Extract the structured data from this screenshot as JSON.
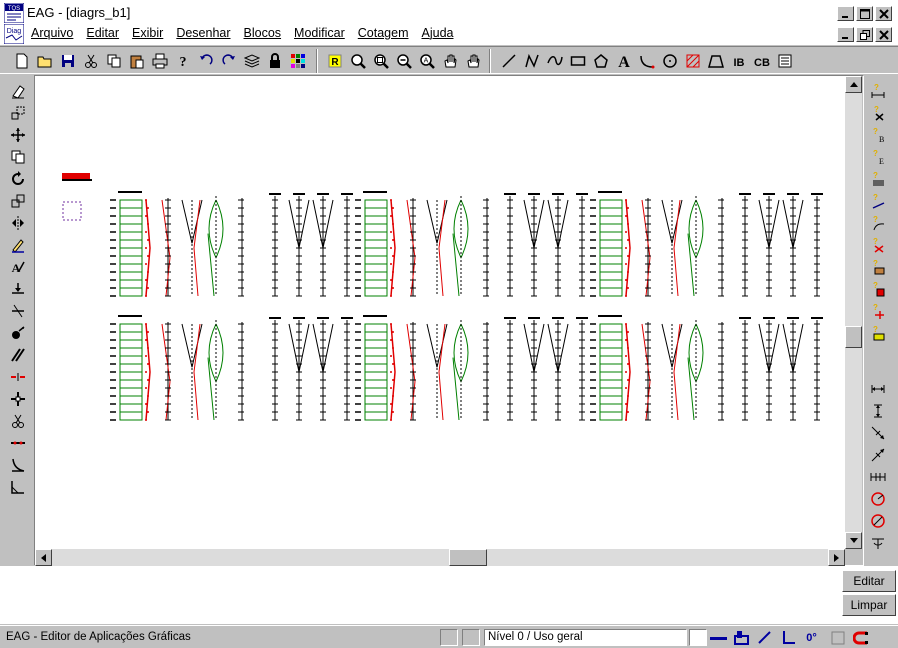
{
  "window": {
    "title": "EAG - [diagrs_b1]",
    "app_icon_text": "TQS"
  },
  "menu": {
    "doc_icon_text": "Diag",
    "items": [
      "Arquivo",
      "Editar",
      "Exibir",
      "Desenhar",
      "Blocos",
      "Modificar",
      "Cotagem",
      "Ajuda"
    ]
  },
  "toolbar": {
    "file_tools": [
      "new-icon",
      "open-icon",
      "save-icon",
      "cut-icon",
      "copy-icon",
      "paste-icon",
      "print-icon",
      "help-icon",
      "undo-icon",
      "redo-icon",
      "layers-icon",
      "lock-icon",
      "grid-icon"
    ],
    "view_tools": [
      "redraw-icon",
      "zoom-icon",
      "zoom-window-icon",
      "zoom-out-icon",
      "zoom-all-icon",
      "pan-icon",
      "pan-hand-icon"
    ],
    "draw_tools": [
      "line-icon",
      "polyline-icon",
      "curve-icon",
      "rectangle-icon",
      "polygon-icon",
      "text-icon",
      "arc-icon",
      "circle-icon",
      "hatch-icon",
      "trapezoid-icon",
      "insert-block-icon",
      "create-block-icon",
      "block-list-icon"
    ],
    "redraw_label": "R",
    "text_label": "A",
    "insert_block_label": "IB",
    "create_block_label": "CB"
  },
  "left_tools": [
    "erase-icon",
    "scale-icon",
    "move-icon",
    "copy-icon",
    "rotate-icon",
    "stretch-icon",
    "mirror-icon",
    "edit-icon",
    "edit-text-icon",
    "extend-icon",
    "trim-icon",
    "fillet-icon",
    "offset-icon",
    "break-icon",
    "array-icon",
    "cut-icon",
    "divide-icon",
    "chamfer-icon",
    "corner-icon"
  ],
  "right_tools_top": [
    "dim-horizontal-icon",
    "dim-delete-icon",
    "dim-b-icon",
    "dim-e-icon",
    "dim-stack-icon",
    "dim-aligned-icon",
    "dim-curve-icon",
    "dim-cross-icon",
    "dim-box-icon",
    "dim-block-icon",
    "dim-move-icon",
    "dim-list-icon"
  ],
  "right_tools_bottom": [
    "dim-linear-icon",
    "dim-vertical-icon",
    "dim-diagonal-icon",
    "dim-diagonal2-icon",
    "dim-chain-icon",
    "dim-radius-icon",
    "dim-diameter-icon",
    "dim-angle-icon"
  ],
  "buttons": {
    "editar": "Editar",
    "limpar": "Limpar"
  },
  "status": {
    "text": "EAG - Editor de Aplicações Gráficas",
    "nivel": "Nível 0 / Uso geral",
    "angle_label": "0°"
  },
  "colors": {
    "green": "#008000",
    "red": "#e00000",
    "blue": "#0000a0"
  }
}
